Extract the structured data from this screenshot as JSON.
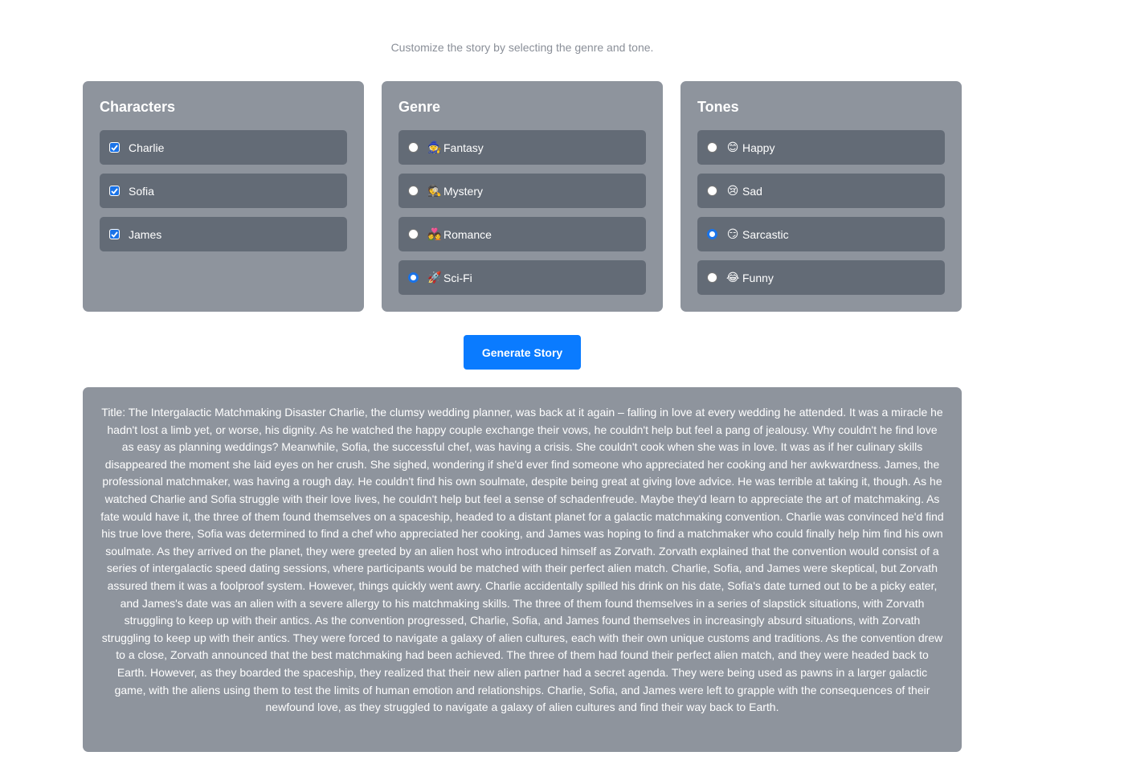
{
  "subtitle": "Customize the story by selecting the genre and tone.",
  "characters": {
    "title": "Characters",
    "items": [
      {
        "label": "Charlie",
        "checked": true
      },
      {
        "label": "Sofia",
        "checked": true
      },
      {
        "label": "James",
        "checked": true
      }
    ]
  },
  "genre": {
    "title": "Genre",
    "items": [
      {
        "emoji": "🧙",
        "label": "Fantasy",
        "selected": false
      },
      {
        "emoji": "🕵",
        "label": "Mystery",
        "selected": false
      },
      {
        "emoji": "💑",
        "label": "Romance",
        "selected": false
      },
      {
        "emoji": "🚀",
        "label": "Sci-Fi",
        "selected": true
      }
    ]
  },
  "tones": {
    "title": "Tones",
    "items": [
      {
        "emoji": "😊",
        "label": "Happy",
        "selected": false
      },
      {
        "emoji": "😢",
        "label": "Sad",
        "selected": false
      },
      {
        "emoji": "😏",
        "label": "Sarcastic",
        "selected": true
      },
      {
        "emoji": "😂",
        "label": "Funny",
        "selected": false
      }
    ]
  },
  "generate_label": "Generate Story",
  "story": "Title: The Intergalactic Matchmaking Disaster Charlie, the clumsy wedding planner, was back at it again – falling in love at every wedding he attended. It was a miracle he hadn't lost a limb yet, or worse, his dignity. As he watched the happy couple exchange their vows, he couldn't help but feel a pang of jealousy. Why couldn't he find love as easy as planning weddings? Meanwhile, Sofia, the successful chef, was having a crisis. She couldn't cook when she was in love. It was as if her culinary skills disappeared the moment she laid eyes on her crush. She sighed, wondering if she'd ever find someone who appreciated her cooking and her awkwardness. James, the professional matchmaker, was having a rough day. He couldn't find his own soulmate, despite being great at giving love advice. He was terrible at taking it, though. As he watched Charlie and Sofia struggle with their love lives, he couldn't help but feel a sense of schadenfreude. Maybe they'd learn to appreciate the art of matchmaking. As fate would have it, the three of them found themselves on a spaceship, headed to a distant planet for a galactic matchmaking convention. Charlie was convinced he'd find his true love there, Sofia was determined to find a chef who appreciated her cooking, and James was hoping to find a matchmaker who could finally help him find his own soulmate. As they arrived on the planet, they were greeted by an alien host who introduced himself as Zorvath. Zorvath explained that the convention would consist of a series of intergalactic speed dating sessions, where participants would be matched with their perfect alien match. Charlie, Sofia, and James were skeptical, but Zorvath assured them it was a foolproof system. However, things quickly went awry. Charlie accidentally spilled his drink on his date, Sofia's date turned out to be a picky eater, and James's date was an alien with a severe allergy to his matchmaking skills. The three of them found themselves in a series of slapstick situations, with Zorvath struggling to keep up with their antics. As the convention progressed, Charlie, Sofia, and James found themselves in increasingly absurd situations, with Zorvath struggling to keep up with their antics. They were forced to navigate a galaxy of alien cultures, each with their own unique customs and traditions. As the convention drew to a close, Zorvath announced that the best matchmaking had been achieved. The three of them had found their perfect alien match, and they were headed back to Earth. However, as they boarded the spaceship, they realized that their new alien partner had a secret agenda. They were being used as pawns in a larger galactic game, with the aliens using them to test the limits of human emotion and relationships. Charlie, Sofia, and James were left to grapple with the consequences of their newfound love, as they struggled to navigate a galaxy of alien cultures and find their way back to Earth.",
  "colors": {
    "panel": "#8e949d",
    "option": "#636b76",
    "accent": "#0a7bff"
  }
}
